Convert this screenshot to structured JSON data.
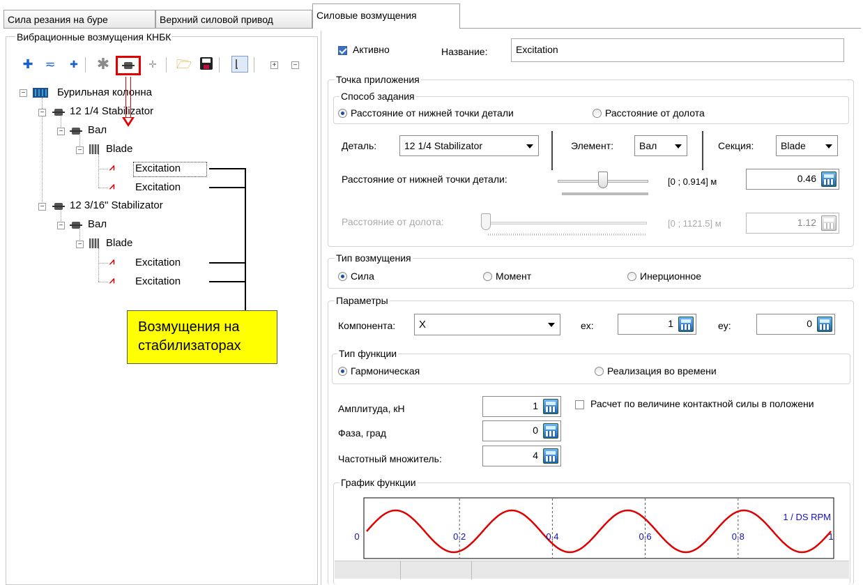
{
  "tabs": [
    "Сила резания на буре",
    "Верхний силовой привод",
    "Силовые возмущения"
  ],
  "left": {
    "title": "Вибрационные возмущения КНБК",
    "toolbar": {
      "plus": "+",
      "minus": "−"
    },
    "tree": {
      "root": "Бурильная колонна",
      "stab1": "12 1/4 Stabilizator",
      "shaft1": "Вал",
      "blade1": "Blade",
      "exc1a": "Excitation",
      "exc1b": "Excitation",
      "stab2": "12 3/16\" Stabilizator",
      "shaft2": "Вал",
      "blade2": "Blade",
      "exc2a": "Excitation",
      "exc2b": "Excitation"
    },
    "callout": "Возмущения на стабилизаторах"
  },
  "right": {
    "active_label": "Активно",
    "name_label": "Название:",
    "name_value": "Excitation",
    "point": {
      "title": "Точка приложения",
      "method_title": "Способ задания",
      "method_opt1": "Расстояние от нижней точки детали",
      "method_opt2": "Расстояние от долота",
      "part_label": "Деталь:",
      "part_value": "12 1/4 Stabilizator",
      "element_label": "Элемент:",
      "element_value": "Вал",
      "section_label": "Секция:",
      "section_value": "Blade",
      "dist_bottom_label": "Расстояние от нижней точки детали:",
      "dist_bottom_range": "[0 ; 0.914] м",
      "dist_bottom_value": "0.46",
      "dist_bit_label": "Расстояние от долота:",
      "dist_bit_range": "[0 ; 1121.5] м",
      "dist_bit_value": "1.12"
    },
    "excitation_type": {
      "title": "Тип возмущения",
      "opt1": "Сила",
      "opt2": "Момент",
      "opt3": "Инерционное"
    },
    "params": {
      "title": "Параметры",
      "component_label": "Компонента:",
      "component_value": "X",
      "ex_label": "ex:",
      "ex_value": "1",
      "ey_label": "ey:",
      "ey_value": "0",
      "func_type_title": "Тип функции",
      "func_opt1": "Гармоническая",
      "func_opt2": "Реализация во времени",
      "amp_label": "Амплитуда, кН",
      "amp_value": "1",
      "contact_label": "Расчет по величине контактной силы в положени",
      "phase_label": "Фаза, град",
      "phase_value": "0",
      "freq_label": "Частотный множитель:",
      "freq_value": "4"
    },
    "graph": {
      "title": "График функции",
      "unit_label": "1 / DS RPM",
      "ticks": [
        "0",
        "0.2",
        "0.4",
        "0.6",
        "0.8",
        "1"
      ]
    }
  },
  "chart_data": {
    "type": "line",
    "title": "График функции",
    "xlabel": "1 / DS RPM",
    "xlim": [
      0,
      1
    ],
    "ylim": [
      -1,
      1
    ],
    "series": [
      {
        "function": "sin(2*pi*4*x)",
        "x": [
          0,
          0.0625,
          0.125,
          0.1875,
          0.25,
          0.3125,
          0.375,
          0.4375,
          0.5,
          0.5625,
          0.625,
          0.6875,
          0.75,
          0.8125,
          0.875,
          0.9375,
          1
        ],
        "values": [
          0,
          1,
          0,
          -1,
          0,
          1,
          0,
          -1,
          0,
          1,
          0,
          -1,
          0,
          1,
          0,
          -1,
          0
        ]
      }
    ],
    "x_ticks": [
      0,
      0.2,
      0.4,
      0.6,
      0.8,
      1
    ],
    "color": "#e00000"
  },
  "colors": {
    "accent": "#e00000",
    "callout_bg": "#ffff00",
    "radio": "#1a4fa0"
  }
}
